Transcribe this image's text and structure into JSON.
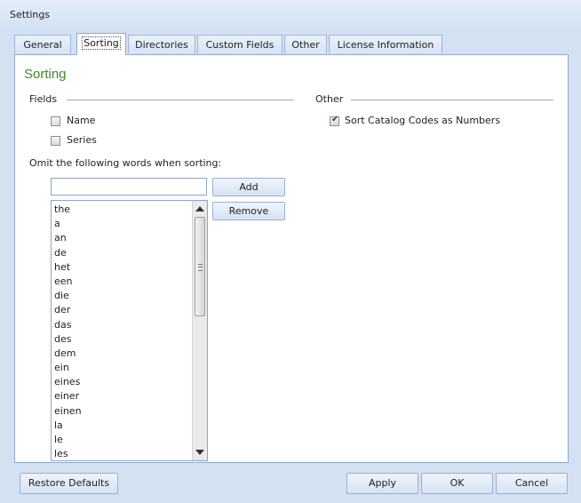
{
  "window": {
    "title": "Settings"
  },
  "tabs": [
    {
      "label": "General"
    },
    {
      "label": "Sorting",
      "active": true
    },
    {
      "label": "Directories"
    },
    {
      "label": "Custom Fields"
    },
    {
      "label": "Other"
    },
    {
      "label": "License Information"
    }
  ],
  "panel": {
    "title": "Sorting",
    "fields_group": {
      "label": "Fields",
      "options": [
        {
          "label": "Name",
          "checked": false
        },
        {
          "label": "Series",
          "checked": false
        }
      ]
    },
    "other_group": {
      "label": "Other",
      "options": [
        {
          "label": "Sort Catalog Codes as Numbers",
          "checked": true
        }
      ]
    },
    "omit": {
      "label": "Omit the following words when sorting:",
      "input_value": "",
      "add_label": "Add",
      "remove_label": "Remove",
      "words": [
        "the",
        "a",
        "an",
        "de",
        "het",
        "een",
        "die",
        "der",
        "das",
        "des",
        "dem",
        "ein",
        "eines",
        "einer",
        "einen",
        "la",
        "le",
        "les"
      ]
    }
  },
  "footer": {
    "restore_label": "Restore Defaults",
    "apply_label": "Apply",
    "ok_label": "OK",
    "cancel_label": "Cancel"
  }
}
